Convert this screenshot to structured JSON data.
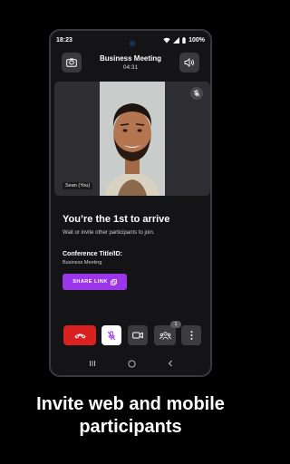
{
  "status_bar": {
    "time": "18:23",
    "battery": "100%",
    "icons": [
      "wifi-icon",
      "signal-icon",
      "battery-icon"
    ]
  },
  "header": {
    "title": "Business Meeting",
    "timer": "04:31",
    "left_button_icon": "camera-switch-icon",
    "right_button_icon": "speaker-icon"
  },
  "video": {
    "participant_name": "Sean (You)",
    "mute_indicator_icon": "mic-off-icon"
  },
  "lobby": {
    "title": "You’re the 1st to arrive",
    "subtitle": "Wait or invite other participants to join.",
    "conference_label": "Conference Title/ID:",
    "conference_value": "Business Meeting",
    "share_button_label": "SHARE LINK",
    "share_button_icon": "copy-icon"
  },
  "controls": {
    "end_call_icon": "phone-hangup-icon",
    "mic_icon": "mic-off-icon",
    "camera_icon": "video-camera-icon",
    "participants_icon": "participants-icon",
    "participants_count": "1",
    "more_icon": "more-vertical-icon"
  },
  "colors": {
    "accent": "#9b37e8",
    "end_call": "#d92121",
    "background": "#141416",
    "tile": "#2e2e32"
  },
  "caption": {
    "line1": "Invite web and mobile",
    "line2": "participants"
  }
}
